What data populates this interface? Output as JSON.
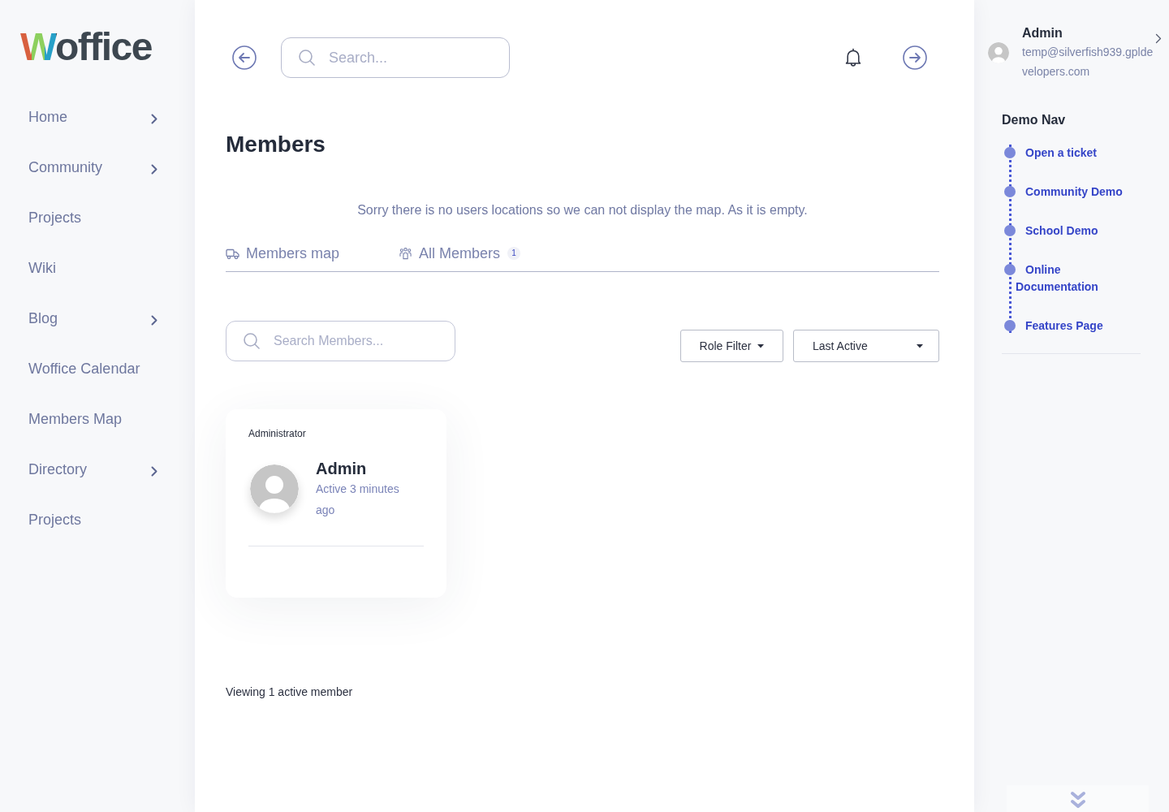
{
  "sidebar": {
    "logo": "Woffice",
    "items": [
      {
        "label": "Home",
        "has_submenu": true
      },
      {
        "label": "Community",
        "has_submenu": true
      },
      {
        "label": "Projects",
        "has_submenu": false
      },
      {
        "label": "Wiki",
        "has_submenu": false
      },
      {
        "label": "Blog",
        "has_submenu": true
      },
      {
        "label": "Woffice Calendar",
        "has_submenu": false
      },
      {
        "label": "Members Map",
        "has_submenu": false
      },
      {
        "label": "Directory",
        "has_submenu": true
      },
      {
        "label": "Projects",
        "has_submenu": false
      }
    ]
  },
  "header": {
    "search": {
      "placeholder": "Search..."
    }
  },
  "page": {
    "title": "Members",
    "map_notice": "Sorry there is no users locations so we can not display the map. As it is empty.",
    "tabs": [
      {
        "kind": "map",
        "label": "Members map",
        "selected": false
      },
      {
        "kind": "members",
        "label": "All Members",
        "count": "1",
        "selected": false
      }
    ],
    "member_search": {
      "placeholder": "Search Members..."
    },
    "filters": [
      {
        "kind": "button",
        "label": "Role Filter"
      },
      {
        "kind": "select",
        "label": "Last Active"
      }
    ],
    "members": [
      {
        "role": "Administrator",
        "name": "Admin",
        "activity": "Active 3 minutes ago"
      }
    ],
    "footer_note": "Viewing 1 active member"
  },
  "user_panel": {
    "name": "Admin",
    "email": "temp@silverfish939.gpldevelopers.com"
  },
  "demo_nav": {
    "title": "Demo Nav",
    "links": [
      "Open a ticket",
      "Community Demo",
      "School Demo",
      "Online Documentation",
      "Features Page"
    ]
  }
}
